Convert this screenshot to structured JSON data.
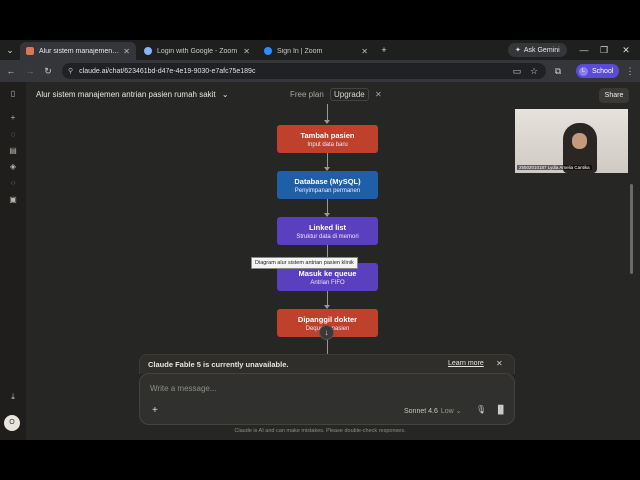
{
  "browser": {
    "tabs": [
      {
        "label": "Alur sistem manajemen antrian",
        "active": true,
        "favicon_color": "#d97757"
      },
      {
        "label": "Login with Google - Zoom",
        "active": false,
        "favicon_color": "#8ab4f8"
      },
      {
        "label": "Sign In | Zoom",
        "active": false,
        "favicon_color": "#2d8cff"
      }
    ],
    "ask_gemini": "Ask Gemini",
    "url": "claude.ai/chat/623461bd-d47e-4e19-9030-e7afc75e189c",
    "profile_label": "School",
    "profile_initial": "L"
  },
  "header": {
    "conversation_title": "Alur sistem manajemen antrian pasien rumah sakit",
    "plan_label": "Free plan",
    "upgrade_label": "Upgrade",
    "share_label": "Share"
  },
  "diagram": {
    "nodes": [
      {
        "title": "Tambah pasien",
        "subtitle": "Input data baru",
        "color": "#c0412b"
      },
      {
        "title": "Database (MySQL)",
        "subtitle": "Penyimpanan permanen",
        "color": "#1f5fa8"
      },
      {
        "title": "Linked list",
        "subtitle": "Struktur data di memori",
        "color": "#5a3fbf"
      },
      {
        "title": "Masuk ke queue",
        "subtitle": "Antrian FIFO",
        "color": "#5a3fbf"
      },
      {
        "title": "Dipanggil dokter",
        "subtitle": "Dequeue pasien",
        "color": "#c0412b"
      }
    ],
    "tooltip": "Diagram alur sistem antrian pasien klinik"
  },
  "video": {
    "participant_name": "25502010187 Lydia Amelia Cantika"
  },
  "banner": {
    "message": "Claude Fable 5 is currently unavailable.",
    "learn_more": "Learn more"
  },
  "composer": {
    "placeholder": "Write a message...",
    "model": "Sonnet 4.6",
    "effort": "Low"
  },
  "disclaimer": "Claude is AI and can make mistakes. Please double-check responses.",
  "user_initial": "O"
}
